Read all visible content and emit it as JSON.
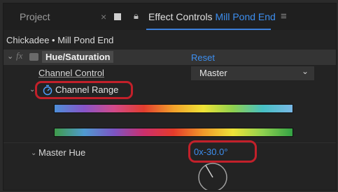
{
  "tabs": {
    "project_label": "Project",
    "close_glyph": "×",
    "effect_controls_label": "Effect Controls",
    "clip_name": "Mill Pond End",
    "menu_glyph": "≡"
  },
  "breadcrumb": "Chickadee • Mill Pond End",
  "effect": {
    "collapse_glyph": "⌄",
    "fx_glyph": "fx",
    "name": "Hue/Saturation",
    "reset_label": "Reset"
  },
  "channel_control": {
    "label": "Channel Control",
    "value": "Master",
    "dropdown_glyph": "⌄"
  },
  "channel_range": {
    "collapse_glyph": "⌄",
    "label": "Channel Range"
  },
  "master_hue": {
    "collapse_glyph": "⌄",
    "label": "Master Hue",
    "value": "0x-30.0°"
  },
  "colors": {
    "accent_blue": "#3d8ff0",
    "highlight_red": "#c2202a",
    "panel_bg": "#232323"
  },
  "icons": [
    "close-icon",
    "square-icon",
    "lock-icon",
    "panel-menu-icon",
    "fx-icon",
    "stopwatch-icon",
    "chevron-down-icon",
    "dial-icon"
  ]
}
